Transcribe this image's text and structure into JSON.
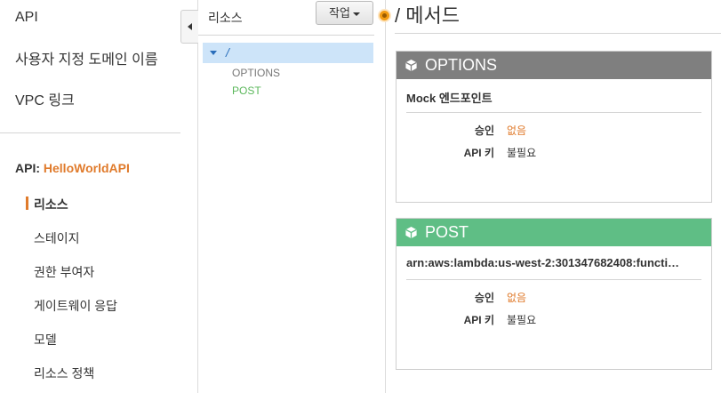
{
  "nav": {
    "top_items": [
      "API",
      "사용자 지정 도메인 이름",
      "VPC 링크"
    ],
    "api_prefix": "API: ",
    "api_name": "HelloWorldAPI",
    "sub_items": [
      "리소스",
      "스테이지",
      "권한 부여자",
      "게이트웨이 응답",
      "모델",
      "리소스 정책"
    ],
    "active_sub_item": "리소스"
  },
  "tree": {
    "title": "리소스",
    "actions_label": "작업",
    "root_path": "/",
    "methods": [
      "OPTIONS",
      "POST"
    ]
  },
  "main": {
    "title": "/ 메서드",
    "cards": [
      {
        "method": "OPTIONS",
        "subtitle": "Mock 엔드포인트",
        "rows": [
          {
            "key": "승인",
            "value": "없음"
          },
          {
            "key": "API 키",
            "value": "불필요"
          }
        ]
      },
      {
        "method": "POST",
        "subtitle": "arn:aws:lambda:us-west-2:301347682408:functi…",
        "rows": [
          {
            "key": "승인",
            "value": "없음"
          },
          {
            "key": "API 키",
            "value": "불필요"
          }
        ]
      }
    ]
  },
  "colors": {
    "accent_orange": "#e07b2c",
    "options_header": "#7f7f7f",
    "post_header": "#5fbe85",
    "tree_selected": "#cde4f9",
    "link_blue": "#2a6ebb",
    "post_green": "#5cb85c"
  },
  "icons": {
    "method_card": "cube-icon",
    "tree_expander": "caret-down-icon",
    "nav_collapse": "caret-left-icon",
    "actions_dropdown": "caret-down-icon",
    "panel_resize": "resize-handle-icon"
  }
}
